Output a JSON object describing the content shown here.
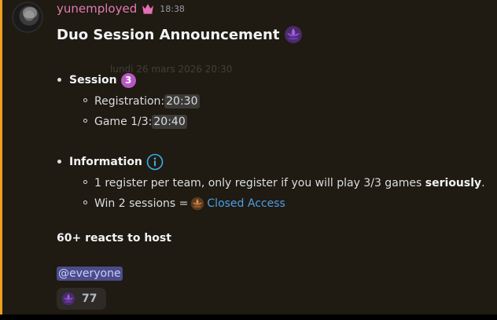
{
  "message": {
    "username": "yunemployed",
    "owner_icon": "crown-icon",
    "timestamp": "18:38",
    "avatar": "user-avatar",
    "ghost_text": "lundi 26 mars 2026 20:30",
    "title": "Duo Session Announcement",
    "title_emoji": "purple-lotus-emoji",
    "session": {
      "label": "Session",
      "badge": "3",
      "items": [
        {
          "label": "Registration: ",
          "time": "20:30"
        },
        {
          "label": "Game 1/3: ",
          "time": "20:40"
        }
      ]
    },
    "information": {
      "label": "Information",
      "icon": "info-icon",
      "line1_prefix": "1 register per team, only register if you will play 3/3 games ",
      "line1_bold": "seriously",
      "line1_suffix": ".",
      "line2_prefix": "Win 2 sessions = ",
      "line2_emoji": "bronze-lotus-emoji",
      "line2_link": "Closed Access"
    },
    "host_text": "60+ reacts to host",
    "mention": "@everyone",
    "reaction": {
      "emoji": "purple-lotus-emoji",
      "count": "77"
    }
  },
  "colors": {
    "background": "#1f1a12",
    "accent_bar": "#f0a020",
    "username": "#e27cb3",
    "link": "#4a9fe8",
    "mention_bg": "#4a4d8a",
    "badge": "#b857c4"
  }
}
